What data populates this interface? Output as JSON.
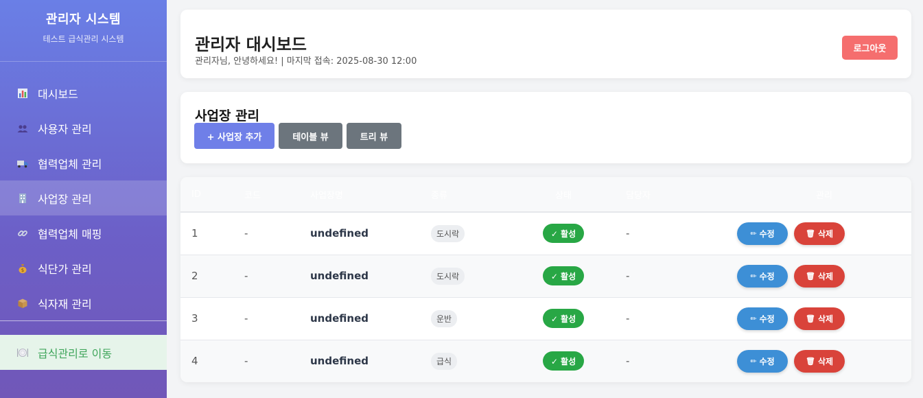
{
  "sidebar": {
    "title": "관리자 시스템",
    "subtitle": "테스트 급식관리 시스템",
    "items": [
      {
        "label": "대시보드",
        "icon": "bar-chart-icon"
      },
      {
        "label": "사용자 관리",
        "icon": "users-icon"
      },
      {
        "label": "협력업체 관리",
        "icon": "truck-icon"
      },
      {
        "label": "사업장 관리",
        "icon": "building-icon",
        "active": true
      },
      {
        "label": "협력업체 매핑",
        "icon": "link-icon"
      },
      {
        "label": "식단가 관리",
        "icon": "money-bag-icon"
      },
      {
        "label": "식자재 관리",
        "icon": "package-icon"
      }
    ],
    "footer_link": {
      "label": "급식관리로 이동",
      "icon": "plate-icon"
    }
  },
  "header": {
    "title": "관리자 대시보드",
    "subtitle": "관리자님, 안녕하세요! | 마지막 접속: 2025-08-30 12:00",
    "logout_label": "로그아웃"
  },
  "site_management": {
    "title": "사업장 관리",
    "add_label": "+ 사업장 추가",
    "table_view_label": "테이블 뷰",
    "tree_view_label": "트리 뷰"
  },
  "table": {
    "columns": [
      "ID",
      "코드",
      "사업장명",
      "종류",
      "상태",
      "담당자",
      "관리"
    ],
    "rows": [
      {
        "id": "1",
        "code": "-",
        "name": "undefined",
        "type": "도시락",
        "status": "✓ 활성",
        "manager": "-",
        "edit": "수정",
        "delete": "삭제"
      },
      {
        "id": "2",
        "code": "-",
        "name": "undefined",
        "type": "도시락",
        "status": "✓ 활성",
        "manager": "-",
        "edit": "수정",
        "delete": "삭제"
      },
      {
        "id": "3",
        "code": "-",
        "name": "undefined",
        "type": "운반",
        "status": "✓ 활성",
        "manager": "-",
        "edit": "수정",
        "delete": "삭제"
      },
      {
        "id": "4",
        "code": "-",
        "name": "undefined",
        "type": "급식",
        "status": "✓ 활성",
        "manager": "-",
        "edit": "수정",
        "delete": "삭제"
      }
    ]
  },
  "colors": {
    "sidebar_gradient_top": "#6a7fe6",
    "sidebar_gradient_bottom": "#7157b8",
    "logout": "#f56e6e",
    "primary": "#6f7fe8",
    "secondary": "#6c757d",
    "success": "#28a745",
    "edit": "#3d8fd6",
    "delete": "#d9433a"
  }
}
